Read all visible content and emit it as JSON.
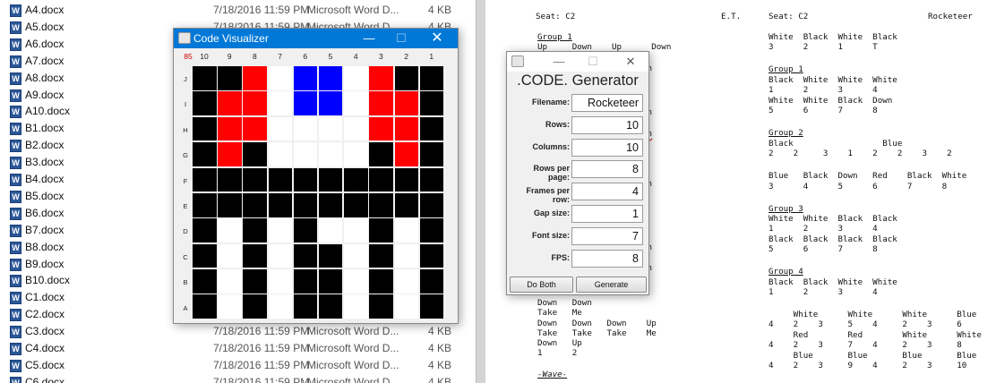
{
  "explorer": {
    "files": [
      {
        "name": "A4.docx",
        "date": "7/18/2016 11:59 PM",
        "type": "Microsoft Word D...",
        "size": "4 KB"
      },
      {
        "name": "A5.docx",
        "date": "7/18/2016 11:59 PM",
        "type": "Microsoft Word D...",
        "size": "4 KB"
      },
      {
        "name": "A6.docx",
        "date": "",
        "type": "",
        "size": ""
      },
      {
        "name": "A7.docx",
        "date": "",
        "type": "",
        "size": ""
      },
      {
        "name": "A8.docx",
        "date": "",
        "type": "",
        "size": ""
      },
      {
        "name": "A9.docx",
        "date": "",
        "type": "",
        "size": ""
      },
      {
        "name": "A10.docx",
        "date": "",
        "type": "",
        "size": ""
      },
      {
        "name": "B1.docx",
        "date": "",
        "type": "",
        "size": ""
      },
      {
        "name": "B2.docx",
        "date": "",
        "type": "",
        "size": ""
      },
      {
        "name": "B3.docx",
        "date": "",
        "type": "",
        "size": ""
      },
      {
        "name": "B4.docx",
        "date": "",
        "type": "",
        "size": ""
      },
      {
        "name": "B5.docx",
        "date": "",
        "type": "",
        "size": ""
      },
      {
        "name": "B6.docx",
        "date": "",
        "type": "",
        "size": ""
      },
      {
        "name": "B7.docx",
        "date": "",
        "type": "",
        "size": ""
      },
      {
        "name": "B8.docx",
        "date": "",
        "type": "",
        "size": ""
      },
      {
        "name": "B9.docx",
        "date": "",
        "type": "",
        "size": ""
      },
      {
        "name": "B10.docx",
        "date": "",
        "type": "",
        "size": ""
      },
      {
        "name": "C1.docx",
        "date": "",
        "type": "",
        "size": ""
      },
      {
        "name": "C2.docx",
        "date": "",
        "type": "",
        "size": ""
      },
      {
        "name": "C3.docx",
        "date": "7/18/2016 11:59 PM",
        "type": "Microsoft Word D...",
        "size": "4 KB"
      },
      {
        "name": "C4.docx",
        "date": "7/18/2016 11:59 PM",
        "type": "Microsoft Word D...",
        "size": "4 KB"
      },
      {
        "name": "C5.docx",
        "date": "7/18/2016 11:59 PM",
        "type": "Microsoft Word D...",
        "size": "4 KB"
      },
      {
        "name": "C6.docx",
        "date": "7/18/2016 11:59 PM",
        "type": "Microsoft Word D...",
        "size": "4 KB"
      }
    ]
  },
  "document": {
    "col1": {
      "header": "Seat: C2",
      "group1": "Group 1",
      "group1_row1": "Up     Down    Up      Down",
      "frag1": "wn",
      "frag2": "wn",
      "frag3": "wn",
      "frag4": "wn",
      "frag5": "wn",
      "frag6": "wn",
      "lines": [
        "Down   Down",
        "Take   Me",
        "Down   Down   Down    Up",
        "Take   Take   Take    Me",
        "Down   Up",
        "1      2"
      ],
      "wave": "-Wave-"
    },
    "col2": {
      "et": "E.T.",
      "header": "Seat: C2",
      "show": "Rocketeer",
      "intro1": "White  Black  White  Black",
      "intro2": "3      2      1      T",
      "g1": "Group 1",
      "g1a": "Black  White  White  White",
      "g1b": "1      2      3      4",
      "g1c": "White  White  Black  Down",
      "g1d": "5      6      7      8",
      "g2": "Group 2",
      "g2a": "Black                  Blue",
      "g2b": "2    2     3    1    2    2    3    2",
      "g2c": "Blue   Black  Down   Red    Black  White",
      "g2d": "3      4      5      6      7      8",
      "g3": "Group 3",
      "g3a": "White  White  Black  Black",
      "g3b": "1      2      3      4",
      "g3c": "Black  Black  Black  Black",
      "g3d": "5      6      7      8",
      "g4": "Group 4",
      "g4a": "Black  Black  White  White",
      "g4b": "1      2      3      4",
      "t1": "     White      White      White      Blue",
      "t2": "4    2    3     5    4     2    3     6",
      "t3": "     Red        Red        White      White",
      "t4": "4    2    3     7    4     2    3     8",
      "t5": "     Blue       Blue       Blue       Blue",
      "t6": "4    2    3     9    4     2    3     10"
    }
  },
  "visualizer": {
    "title": "Code Visualizer",
    "frame_label": "85",
    "col_labels": [
      "10",
      "9",
      "8",
      "7",
      "6",
      "5",
      "4",
      "3",
      "2",
      "1"
    ],
    "row_labels": [
      "J",
      "I",
      "H",
      "G",
      "F",
      "E",
      "D",
      "C",
      "B",
      "A"
    ],
    "colors": {
      "K": "#000000",
      "W": "#ffffff",
      "R": "#ff0000",
      "B": "#0000ff"
    },
    "grid": [
      "KKRWBBWRKK",
      "KRRWBBWRRK",
      "KRRWWWWRRK",
      "KRKWWWWKRK",
      "KKKKKKKKKK",
      "KKKKKKKKKK",
      "KWKWKWWKWK",
      "KWKWKKWKWK",
      "KWKWKKWKWK",
      "KWKWKKWKWK"
    ]
  },
  "generator": {
    "window_title": "",
    "heading": ".CODE. Generator",
    "fields": [
      {
        "label": "Filename:",
        "value": "Rocketeer"
      },
      {
        "label": "Rows:",
        "value": "10"
      },
      {
        "label": "Columns:",
        "value": "10"
      },
      {
        "label": "Rows per page:",
        "value": "8"
      },
      {
        "label": "Frames per row:",
        "value": "4"
      },
      {
        "label": "Gap size:",
        "value": "1"
      },
      {
        "label": "Font size:",
        "value": "7"
      },
      {
        "label": "FPS:",
        "value": "8"
      }
    ],
    "buttons": {
      "do_both": "Do Both",
      "generate": "Generate"
    }
  },
  "icons": {
    "minimize": "minimize-icon",
    "maximize": "maximize-icon",
    "close": "close-icon",
    "app": "java-app-icon",
    "word": "word-doc-icon"
  }
}
